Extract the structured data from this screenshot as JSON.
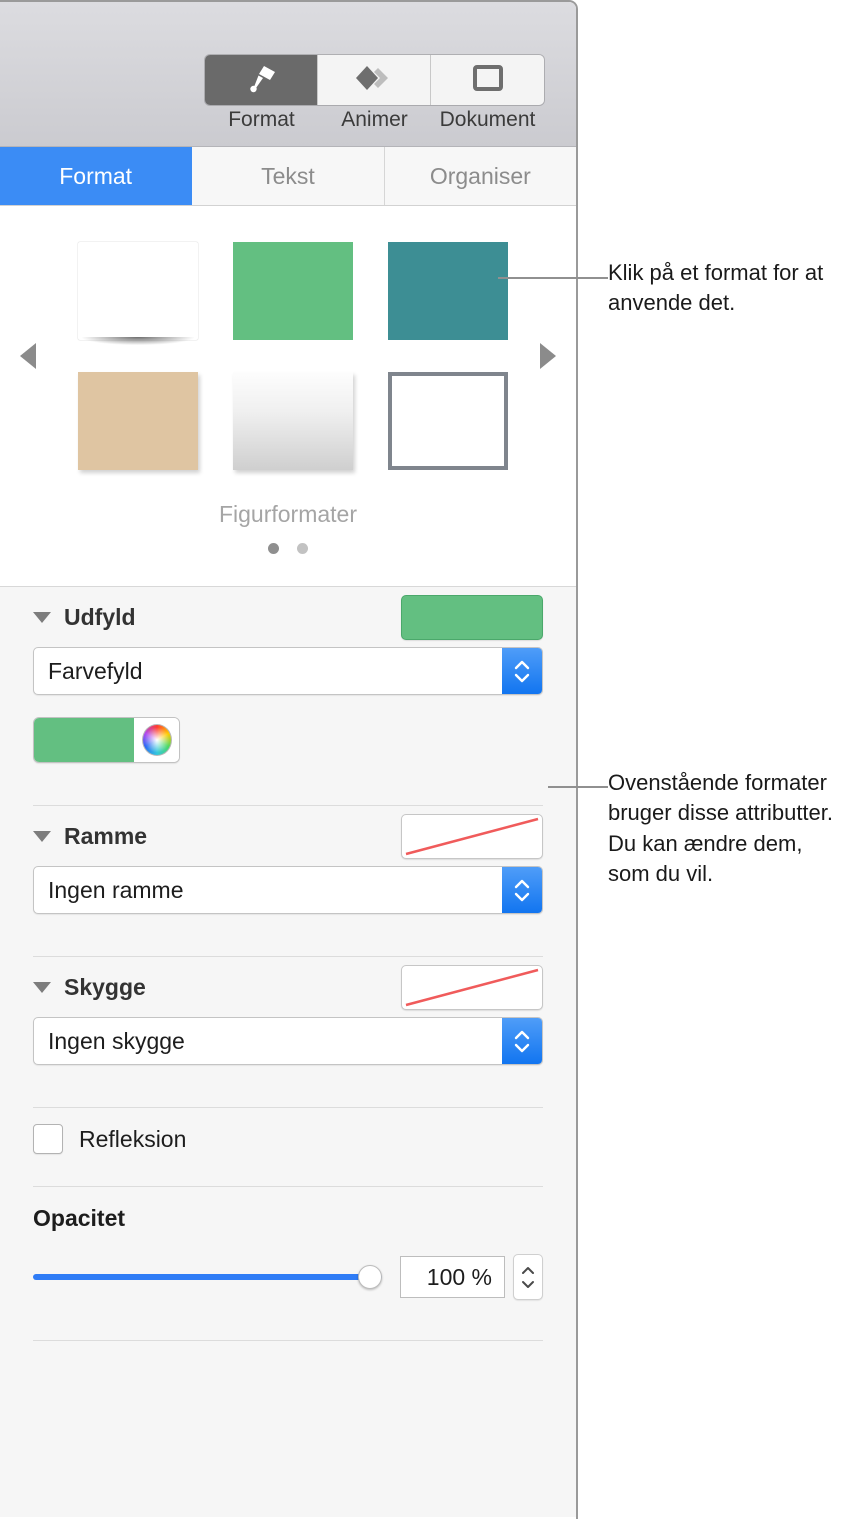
{
  "toolbar": {
    "buttons": [
      {
        "label": "Format",
        "icon": "paint-roller-icon",
        "active": true
      },
      {
        "label": "Animer",
        "icon": "animate-diamond-icon",
        "active": false
      },
      {
        "label": "Dokument",
        "icon": "document-square-icon",
        "active": false
      }
    ]
  },
  "tabs": [
    {
      "label": "Format",
      "active": true
    },
    {
      "label": "Tekst",
      "active": false
    },
    {
      "label": "Organiser",
      "active": false
    }
  ],
  "gallery": {
    "title": "Figurformater",
    "prev_icon": "triangle-left-icon",
    "next_icon": "triangle-right-icon",
    "page_dots": 2,
    "active_dot": 0,
    "swatches": [
      {
        "name": "white-shadow-style",
        "color": "#ffffff"
      },
      {
        "name": "green-style",
        "color": "#63bf81"
      },
      {
        "name": "teal-style",
        "color": "#3d8e94"
      },
      {
        "name": "tan-style",
        "color": "#dfc5a2"
      },
      {
        "name": "gradient-style",
        "color": "#cfcfcf"
      },
      {
        "name": "outline-style",
        "color": "#7f858d"
      }
    ]
  },
  "fill": {
    "title": "Udfyld",
    "preview_color": "#63bf81",
    "popup_value": "Farvefyld",
    "color_well_value": "#63bf81",
    "color_wheel_icon": "color-wheel-icon"
  },
  "border": {
    "title": "Ramme",
    "preview": "none",
    "popup_value": "Ingen ramme"
  },
  "shadow": {
    "title": "Skygge",
    "preview": "none",
    "popup_value": "Ingen skygge"
  },
  "reflection": {
    "label": "Refleksion",
    "checked": false
  },
  "opacity": {
    "title": "Opacitet",
    "value": "100 %",
    "slider_percent": 100
  },
  "callouts": [
    {
      "text": "Klik på et format for at anvende det."
    },
    {
      "text": "Ovenstående formater bruger disse attributter. Du kan ændre dem, som du vil."
    }
  ]
}
